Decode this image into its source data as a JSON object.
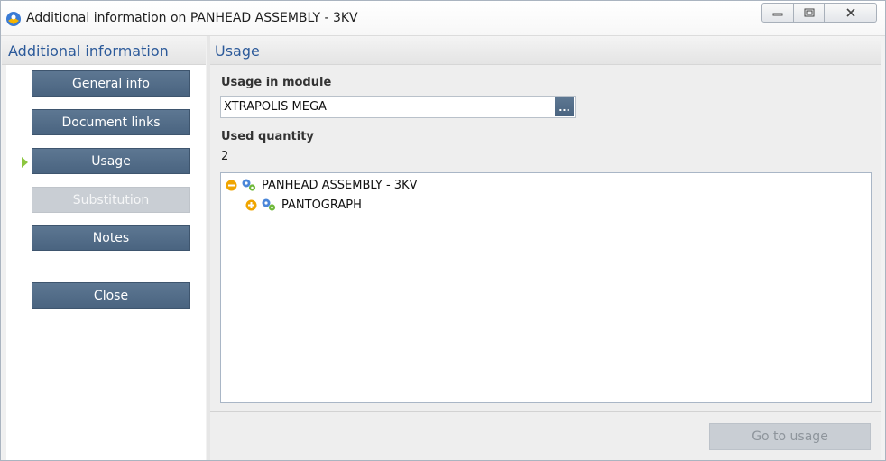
{
  "window": {
    "title": "Additional information on PANHEAD ASSEMBLY - 3KV"
  },
  "left_panel": {
    "header": "Additional information",
    "active_item": "Usage",
    "nav": {
      "general_info": {
        "label": "General info",
        "enabled": true
      },
      "document_links": {
        "label": "Document links",
        "enabled": true
      },
      "usage": {
        "label": "Usage",
        "enabled": true,
        "selected": true
      },
      "substitution": {
        "label": "Substitution",
        "enabled": false
      },
      "notes": {
        "label": "Notes",
        "enabled": true
      },
      "close": {
        "label": "Close",
        "enabled": true
      }
    }
  },
  "main": {
    "header": "Usage",
    "usage_in_module": {
      "label": "Usage in module",
      "value": "XTRAPOLIS MEGA",
      "browse_label": "..."
    },
    "used_quantity": {
      "label": "Used quantity",
      "value": "2"
    },
    "tree": {
      "nodes": [
        {
          "label": "PANHEAD ASSEMBLY - 3KV",
          "state": "expanded",
          "icon": "gears-icon"
        },
        {
          "label": "PANTOGRAPH",
          "state": "collapsed",
          "icon": "gears-icon"
        }
      ]
    },
    "go_to_usage": {
      "label": "Go to usage",
      "enabled": false
    }
  },
  "colors": {
    "accent_blue_text": "#2c5a9a",
    "nav_button": "#4f6984",
    "nav_button_disabled": "#c9ced4",
    "active_arrow": "#8cc63f",
    "expander_orange": "#f0a500"
  }
}
